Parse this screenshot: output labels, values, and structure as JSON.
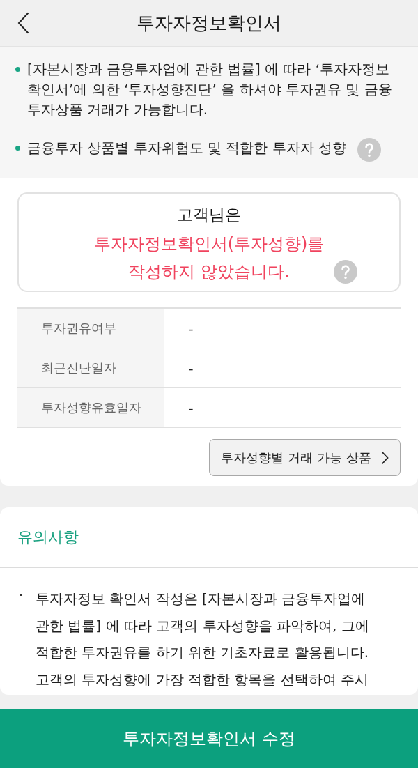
{
  "header": {
    "title": "투자자정보확인서"
  },
  "notice": {
    "items": [
      {
        "text": "[자본시장과 금융투자업에 관한 법률] 에 따라 ‘투자자정보확인서’에 의한 ‘투자성향진단’ 을 하셔야 투자권유 및 금융투자상품 거래가 가능합니다.",
        "help": false
      },
      {
        "text": "금융투자 상품별 투자위험도 및 적합한 투자자 성향",
        "help": true
      }
    ]
  },
  "status": {
    "greeting": "고객님은",
    "message": "투자자정보확인서(투자성향)를 작성하지 않았습니다.",
    "help": true
  },
  "details": {
    "rows": [
      {
        "label": "투자권유여부",
        "value": "-"
      },
      {
        "label": "최근진단일자",
        "value": "-"
      },
      {
        "label": "투자성향유효일자",
        "value": "-"
      }
    ]
  },
  "products_button": {
    "label": "투자성향별 거래 가능 상품"
  },
  "notes": {
    "title": "유의사항",
    "items": [
      "투자자정보 확인서 작성은 [자본시장과 금융투자업에 관한 법률] 에 따라 고객의 투자성향을 파악하여, 그에 적합한 투자권유를 하기 위한 기초자료로 활용됩니다. 고객의 투자성향에 가장 적합한 항목을 선택하여 주시"
    ]
  },
  "footer_button": {
    "label": "투자자정보확인서 수정"
  }
}
